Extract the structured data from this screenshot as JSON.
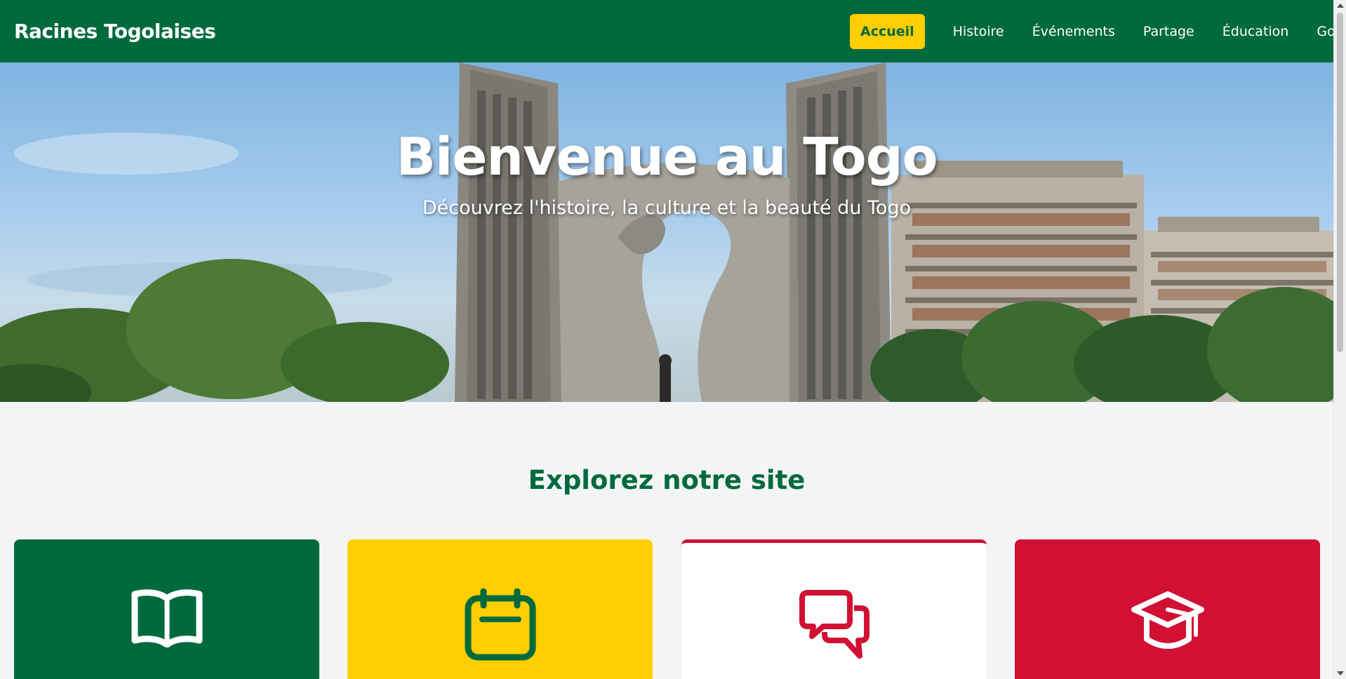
{
  "navbar": {
    "brand": "Racines Togolaises",
    "links": [
      {
        "label": "Accueil",
        "active": true
      },
      {
        "label": "Histoire",
        "active": false
      },
      {
        "label": "Événements",
        "active": false
      },
      {
        "label": "Partage",
        "active": false
      },
      {
        "label": "Éducation",
        "active": false
      },
      {
        "label": "Gouv",
        "active": false
      }
    ]
  },
  "hero": {
    "title": "Bienvenue au Togo",
    "subtitle": "Découvrez l'histoire, la culture et la beauté du Togo"
  },
  "explore": {
    "title": "Explorez notre site",
    "cards": [
      {
        "icon": "book-icon",
        "background": "#006a3d",
        "icon_color": "#ffffff"
      },
      {
        "icon": "calendar-icon",
        "background": "#ffce00",
        "icon_color": "#006a3d"
      },
      {
        "icon": "comments-icon",
        "background": "#ffffff",
        "icon_color": "#d21034"
      },
      {
        "icon": "graduation-cap-icon",
        "background": "#d21034",
        "icon_color": "#ffffff"
      }
    ]
  },
  "colors": {
    "green": "#006a3d",
    "yellow": "#ffce00",
    "red": "#d21034",
    "page_background": "#f2f4f6"
  }
}
